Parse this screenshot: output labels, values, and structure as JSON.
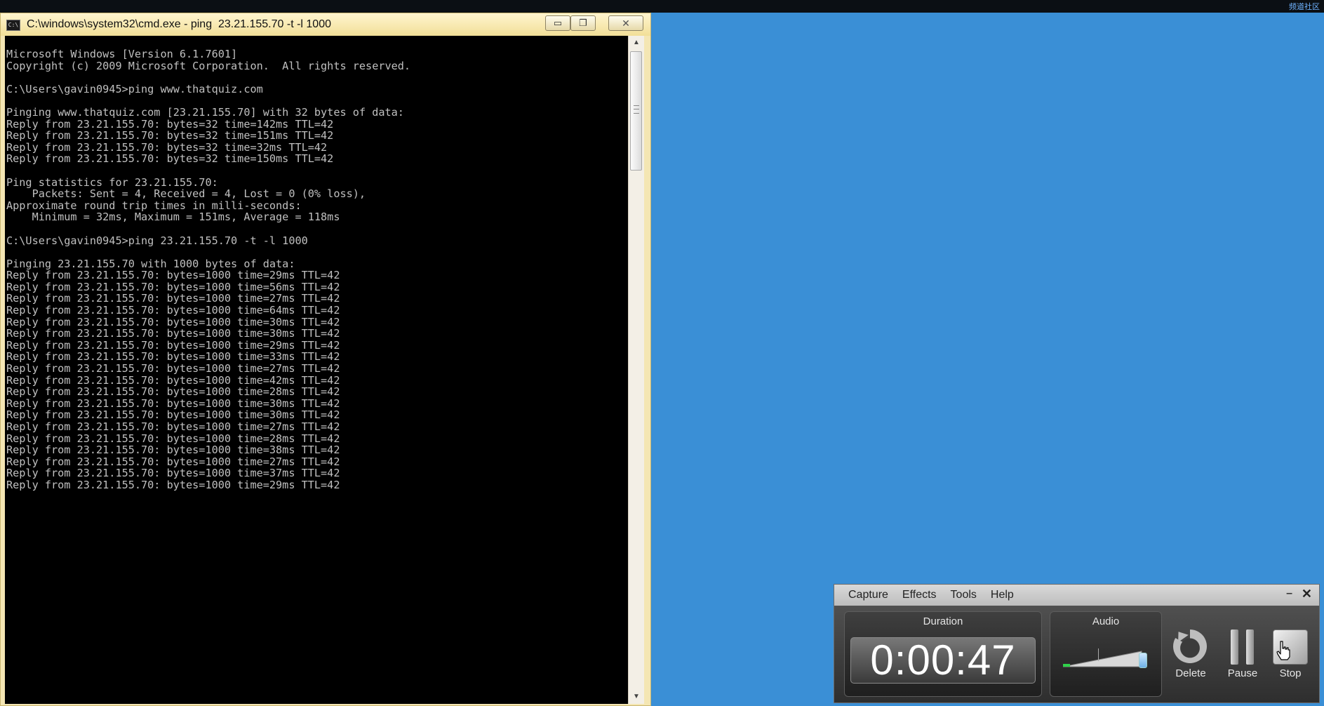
{
  "corner_text": "频道社区",
  "cmd": {
    "icon_label": "C:\\",
    "title": "C:\\windows\\system32\\cmd.exe - ping  23.21.155.70 -t -l 1000",
    "min_glyph": "▭",
    "max_glyph": "❐",
    "close_glyph": "✕",
    "lines": [
      "Microsoft Windows [Version 6.1.7601]",
      "Copyright (c) 2009 Microsoft Corporation.  All rights reserved.",
      "",
      "C:\\Users\\gavin0945>ping www.thatquiz.com",
      "",
      "Pinging www.thatquiz.com [23.21.155.70] with 32 bytes of data:",
      "Reply from 23.21.155.70: bytes=32 time=142ms TTL=42",
      "Reply from 23.21.155.70: bytes=32 time=151ms TTL=42",
      "Reply from 23.21.155.70: bytes=32 time=32ms TTL=42",
      "Reply from 23.21.155.70: bytes=32 time=150ms TTL=42",
      "",
      "Ping statistics for 23.21.155.70:",
      "    Packets: Sent = 4, Received = 4, Lost = 0 (0% loss),",
      "Approximate round trip times in milli-seconds:",
      "    Minimum = 32ms, Maximum = 151ms, Average = 118ms",
      "",
      "C:\\Users\\gavin0945>ping 23.21.155.70 -t -l 1000",
      "",
      "Pinging 23.21.155.70 with 1000 bytes of data:",
      "Reply from 23.21.155.70: bytes=1000 time=29ms TTL=42",
      "Reply from 23.21.155.70: bytes=1000 time=56ms TTL=42",
      "Reply from 23.21.155.70: bytes=1000 time=27ms TTL=42",
      "Reply from 23.21.155.70: bytes=1000 time=64ms TTL=42",
      "Reply from 23.21.155.70: bytes=1000 time=30ms TTL=42",
      "Reply from 23.21.155.70: bytes=1000 time=30ms TTL=42",
      "Reply from 23.21.155.70: bytes=1000 time=29ms TTL=42",
      "Reply from 23.21.155.70: bytes=1000 time=33ms TTL=42",
      "Reply from 23.21.155.70: bytes=1000 time=27ms TTL=42",
      "Reply from 23.21.155.70: bytes=1000 time=42ms TTL=42",
      "Reply from 23.21.155.70: bytes=1000 time=28ms TTL=42",
      "Reply from 23.21.155.70: bytes=1000 time=30ms TTL=42",
      "Reply from 23.21.155.70: bytes=1000 time=30ms TTL=42",
      "Reply from 23.21.155.70: bytes=1000 time=27ms TTL=42",
      "Reply from 23.21.155.70: bytes=1000 time=28ms TTL=42",
      "Reply from 23.21.155.70: bytes=1000 time=38ms TTL=42",
      "Reply from 23.21.155.70: bytes=1000 time=27ms TTL=42",
      "Reply from 23.21.155.70: bytes=1000 time=37ms TTL=42",
      "Reply from 23.21.155.70: bytes=1000 time=29ms TTL=42"
    ]
  },
  "recorder": {
    "menu": [
      "Capture",
      "Effects",
      "Tools",
      "Help"
    ],
    "min_glyph": "–",
    "close_glyph": "✕",
    "duration_label": "Duration",
    "duration_value": "0:00:47",
    "audio_label": "Audio",
    "buttons": {
      "delete": "Delete",
      "pause": "Pause",
      "stop": "Stop"
    }
  },
  "colors": {
    "desktop": "#3a8fd6",
    "console_bg": "#000000",
    "console_text": "#c0c0c0",
    "cmd_frame": "#f4e6b3",
    "audio_level": "#2fd24a"
  },
  "icons": [
    "cmd-app-icon",
    "delete-icon",
    "pause-icon",
    "stop-icon",
    "hand-cursor-icon"
  ]
}
